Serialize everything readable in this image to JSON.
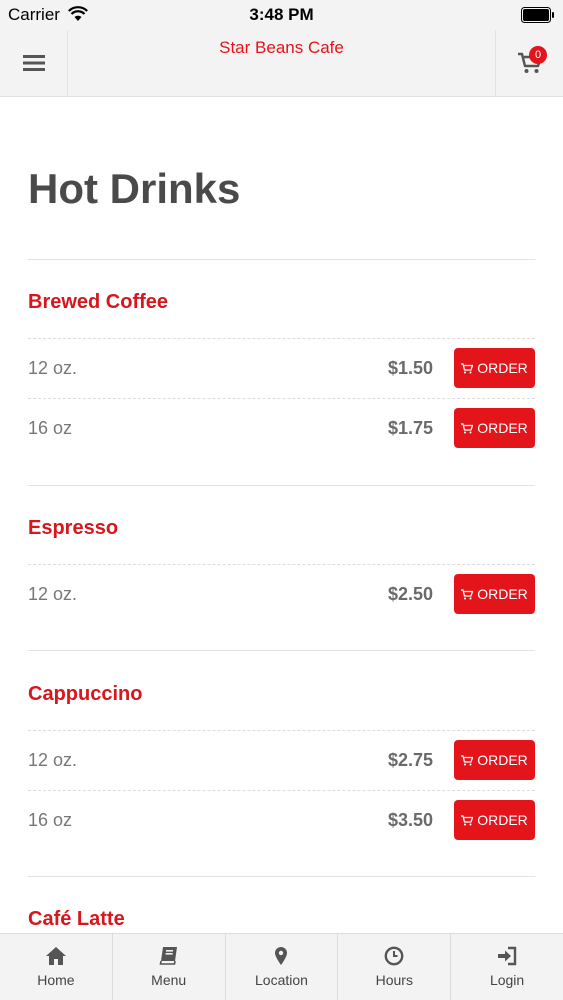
{
  "status_bar": {
    "carrier": "Carrier",
    "time": "3:48 PM"
  },
  "navbar": {
    "title": "Star Beans Cafe",
    "cart_count": "0"
  },
  "page": {
    "title": "Hot Drinks"
  },
  "order_label": "ORDER",
  "sections": [
    {
      "name": "Brewed Coffee",
      "items": [
        {
          "size": "12 oz.",
          "price": "$1.50"
        },
        {
          "size": "16 oz",
          "price": "$1.75"
        }
      ]
    },
    {
      "name": "Espresso",
      "items": [
        {
          "size": "12 oz.",
          "price": "$2.50"
        }
      ]
    },
    {
      "name": "Cappuccino",
      "items": [
        {
          "size": "12 oz.",
          "price": "$2.75"
        },
        {
          "size": "16 oz",
          "price": "$3.50"
        }
      ]
    },
    {
      "name": "Café Latte",
      "items": []
    }
  ],
  "tabbar": {
    "home": "Home",
    "menu": "Menu",
    "location": "Location",
    "hours": "Hours",
    "login": "Login"
  },
  "colors": {
    "accent": "#e4141b",
    "heading": "#4a4a4a",
    "bar": "#f3f3f3"
  }
}
